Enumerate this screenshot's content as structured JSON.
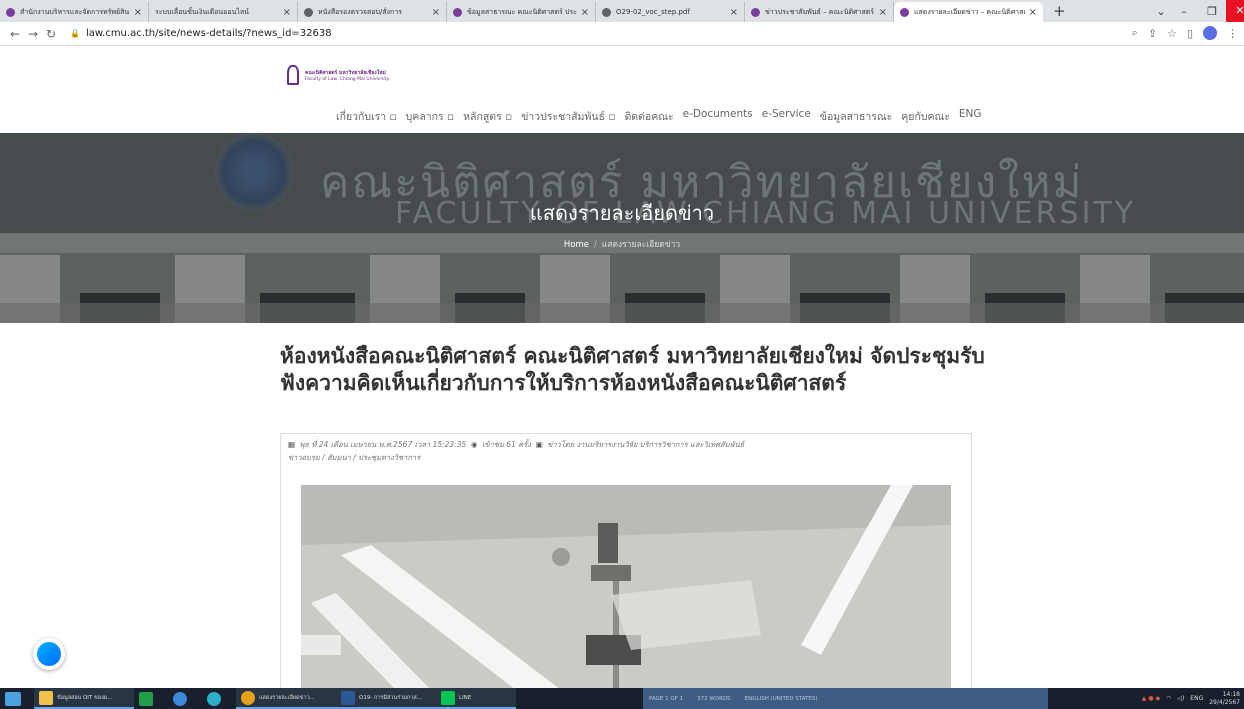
{
  "browser": {
    "tabs": [
      {
        "label": "สำนักงานบริหารและจัดการทรัพย์สิน",
        "active": false
      },
      {
        "label": "ระบบเลื่อนขั้นเงินเดือนออนไลน์",
        "active": false
      },
      {
        "label": "หนังสือรองตรวจสอบ/สั่งการ",
        "active": false
      },
      {
        "label": "ข้อมูลสาธารณะ คณะนิติศาสตร์ ประจำ",
        "active": false
      },
      {
        "label": "O29-02_voc_step.pdf",
        "active": false
      },
      {
        "label": "ข่าวประชาสัมพันธ์ – คณะนิติศาสตร์",
        "active": false
      },
      {
        "label": "แสดงรายละเอียดข่าว – คณะนิติศาสตร์",
        "active": true
      }
    ],
    "new_tab": "+",
    "url": "law.cmu.ac.th/site/news-details/?news_id=32638"
  },
  "site": {
    "logo_th": "คณะนิติศาสตร์ มหาวิทยาลัยเชียงใหม่",
    "logo_en": "Faculty of Law, Chiang Mai University",
    "nav": [
      {
        "label": "เกี่ยวกับเรา",
        "has_dropdown": true
      },
      {
        "label": "บุคลากร",
        "has_dropdown": true
      },
      {
        "label": "หลักสูตร",
        "has_dropdown": true
      },
      {
        "label": "ข่าวประชาสัมพันธ์",
        "has_dropdown": true
      },
      {
        "label": "ติดต่อคณะ",
        "has_dropdown": false
      },
      {
        "label": "e-Documents",
        "has_dropdown": false
      },
      {
        "label": "e-Service",
        "has_dropdown": false
      },
      {
        "label": "ข้อมูลสาธารณะ",
        "has_dropdown": false
      },
      {
        "label": "คุยกับคณะ",
        "has_dropdown": false
      },
      {
        "label": "ENG",
        "has_dropdown": false
      }
    ]
  },
  "hero": {
    "building_text_th": "คณะนิติศาสตร์ มหาวิทยาลัยเชียงใหม่",
    "building_text_en": "FACULTY OF LAW CHIANG MAI UNIVERSITY",
    "title": "แสดงรายละเอียดข่าว",
    "breadcrumb": {
      "home": "Home",
      "separator": "/",
      "current": "แสดงรายละเอียดข่าว"
    }
  },
  "article": {
    "title": "ห้องหนังสือคณะนิติศาสตร์ คณะนิติศาสตร์ มหาวิทยาลัยเชียงใหม่ จัดประชุมรับฟังความคิดเห็นเกี่ยวกับการให้บริการห้องหนังสือคณะนิติศาสตร์",
    "date": "พุธ ที่ 24 เดือน เมษายน พ.ศ.2567 เวลา 15:23:35",
    "views": "เข้าชม 61 ครั้ง",
    "posted_by": "ข่าวโดย งานบริหารงานวิจัย บริการวิชาการ และวิเทศสัมพันธ์",
    "category": "ข่าวอบรม / สัมมนา / ประชุมทางวิชาการ"
  },
  "taskbar": {
    "items": [
      {
        "label": "ข้อมูลสอบ OIT ของม..."
      },
      {
        "label": ""
      },
      {
        "label": ""
      },
      {
        "label": ""
      },
      {
        "label": "แสดงรายละเอียดข่าว..."
      },
      {
        "label": "O19- การมีส่วนร่วมกาส..."
      },
      {
        "label": "LINE"
      }
    ],
    "word_status": [
      "PAGE 1 OF 1",
      "372 WORDS",
      "ENGLISH (UNITED STATES)"
    ],
    "lang": "ENG",
    "time": "14:18",
    "date": "29/4/2567"
  },
  "colors": {
    "brand_purple": "#6b2d8c",
    "close_red": "#e81123",
    "taskbar": "#17202c"
  }
}
